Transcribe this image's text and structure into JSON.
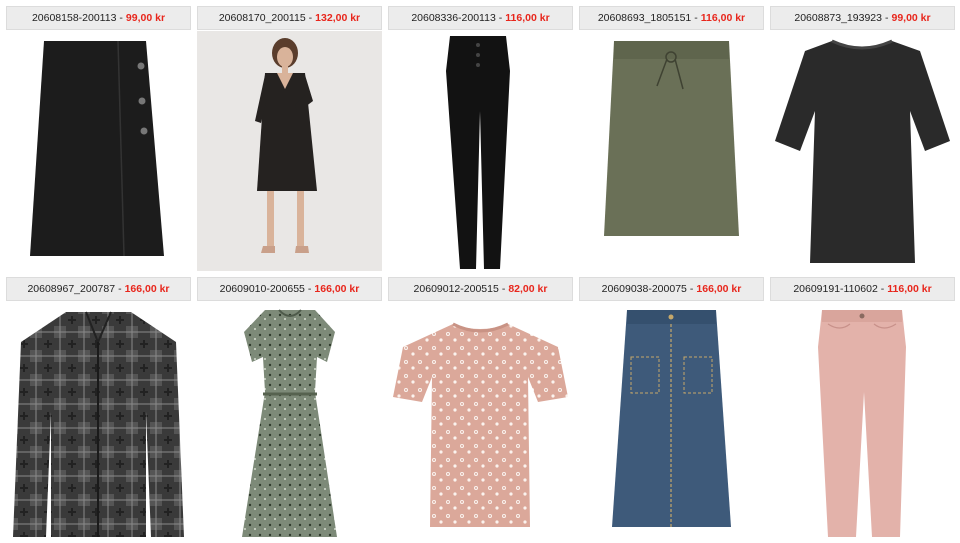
{
  "products": [
    {
      "sku": "20608158-200113",
      "price": "99,00 kr",
      "item": "black-wrap-skirt",
      "color": "#1c1c1c"
    },
    {
      "sku": "20608170_200115",
      "price": "132,00 kr",
      "item": "black-shift-dress-model",
      "color": "#252220"
    },
    {
      "sku": "20608336-200113",
      "price": "116,00 kr",
      "item": "black-skinny-pants",
      "color": "#121212"
    },
    {
      "sku": "20608693_1805151",
      "price": "116,00 kr",
      "item": "olive-drawstring-skirt",
      "color": "#6a7057"
    },
    {
      "sku": "20608873_193923",
      "price": "99,00 kr",
      "item": "dark-knit-top",
      "color": "#2a2a2a"
    },
    {
      "sku": "20608967_200787",
      "price": "166,00 kr",
      "item": "patterned-shirt-jacket",
      "color": "#3a3a3a"
    },
    {
      "sku": "20609010-200655",
      "price": "166,00 kr",
      "item": "floral-midi-dress",
      "color": "#7d8a78"
    },
    {
      "sku": "20609012-200515",
      "price": "82,00 kr",
      "item": "floral-tshirt",
      "color": "#dba89a"
    },
    {
      "sku": "20609038-200075",
      "price": "166,00 kr",
      "item": "denim-midi-skirt",
      "color": "#3e5a7a"
    },
    {
      "sku": "20609191-110602",
      "price": "116,00 kr",
      "item": "pink-cropped-pants",
      "color": "#e3b2aa"
    }
  ],
  "price_color": "#e8261c"
}
